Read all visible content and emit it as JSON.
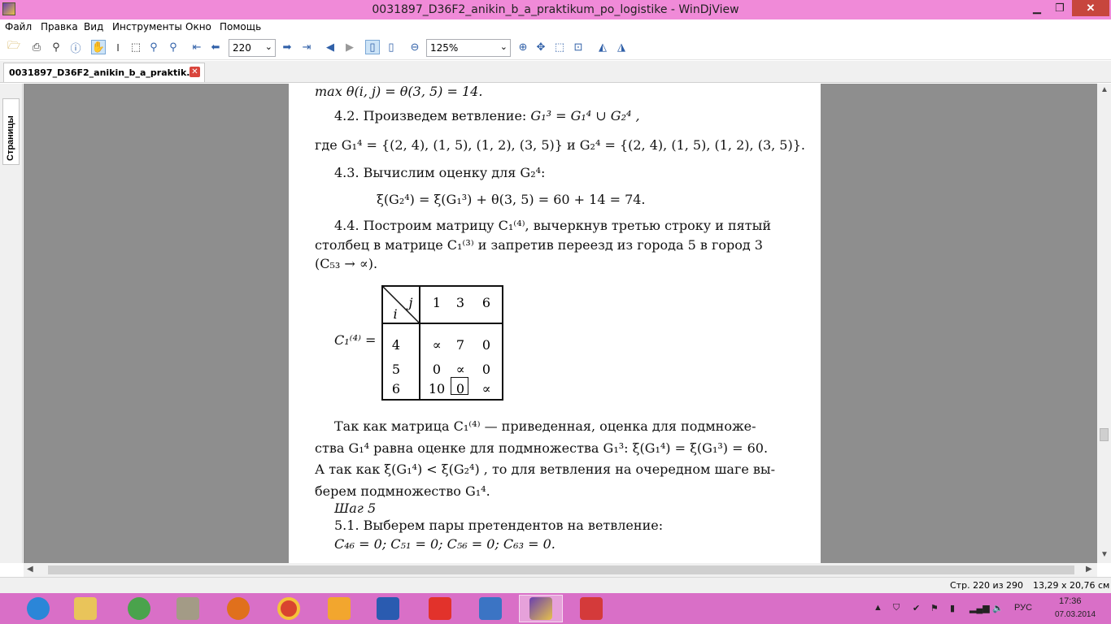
{
  "window": {
    "title": "0031897_D36F2_anikin_b_a_praktikum_po_logistike - WinDjView",
    "min_label": "▁",
    "max_label": "❐",
    "close_label": "✕"
  },
  "menu": [
    "Файл",
    "Правка",
    "Вид",
    "Инструменты",
    "Окно",
    "Помощь"
  ],
  "toolbar": {
    "page_value": "220",
    "zoom_value": "125%",
    "icons": [
      "open-icon",
      "print-icon",
      "find-icon",
      "info-icon",
      "hand-icon",
      "text-select-icon",
      "rect-select-icon",
      "zoom-in-tool-icon",
      "zoom-rect-icon",
      "first-page-icon",
      "prev-page-icon",
      "next-page-icon",
      "last-page-icon",
      "back-icon",
      "forward-icon",
      "single-page-icon",
      "two-page-icon",
      "zoom-out-icon",
      "zoom-plus-icon",
      "fit-page-icon",
      "fit-width-icon",
      "actual-size-icon",
      "rotate-left-icon",
      "rotate-right-icon"
    ]
  },
  "tab": {
    "label": "0031897_D36F2_anikin_b_a_praktik...",
    "close": "✕"
  },
  "sidebar": {
    "pages_tab": "Страницы"
  },
  "doc": {
    "line1": "max θ(i, j) = θ(3, 5) = 14.",
    "l2a": "4.2. Произведем ветвление: ",
    "l2b": "G₁³ = G₁⁴ ∪ G₂⁴ ,",
    "l3a": "где ",
    "l3b": "G₁⁴ = {(2, 4), (1, 5), (1, 2), (3, 5)}",
    "l3c": " и ",
    "l3d": "G₂⁴ = {(2, 4), (1, 5), (1, 2), (3, 5)}.",
    "l4": "4.3. Вычислим оценку для G₂⁴:",
    "l5": "ξ(G₂⁴) = ξ(G₁³) + θ(3, 5) = 60 + 14 = 74.",
    "l6": "4.4. Построим матрицу C₁⁽⁴⁾, вычеркнув третью строку и пятый",
    "l7": "столбец в матрице C₁⁽³⁾ и запретив переезд из города 5 в город 3",
    "l8": "(C₅₃ → ∝).",
    "matrix_label": "C₁⁽⁴⁾ =",
    "matrix": {
      "col_header": "j",
      "row_header": "i",
      "cols": [
        "1",
        "3",
        "6"
      ],
      "rows": [
        {
          "i": "4",
          "cells": [
            "∝",
            "7",
            "0"
          ]
        },
        {
          "i": "5",
          "cells": [
            "0",
            "∝",
            "0"
          ]
        },
        {
          "i": "6",
          "cells": [
            "10",
            "0",
            "∝"
          ]
        }
      ]
    },
    "p1": "Так как матрица C₁⁽⁴⁾ — приведенная, оценка для подмноже-",
    "p2": "ства G₁⁴ равна оценке для подмножества G₁³: ξ(G₁⁴) = ξ(G₁³) = 60.",
    "p3": "А так как ξ(G₁⁴) < ξ(G₂⁴) , то для ветвления на очередном шаге вы-",
    "p4": "берем подмножество G₁⁴.",
    "step": "Шаг 5",
    "s1": "5.1. Выберем пары претендентов на ветвление:",
    "s2": "C₄₆ = 0; C₅₁ = 0; C₅₆ = 0; C₆₃ = 0."
  },
  "status": {
    "page_info": "Стр. 220 из 290",
    "size_info": "13,29 x 20,76 см"
  },
  "taskbar": {
    "apps": [
      "ie-icon",
      "file-explorer-icon",
      "media-center-icon",
      "archive-icon",
      "firefox-icon",
      "chrome-icon",
      "video-player-icon",
      "word-icon",
      "yandex-icon",
      "speaker-app-icon",
      "windjview-icon",
      "remote-icon"
    ],
    "lang": "РУС",
    "time": "17:36",
    "date": "07.03.2014"
  }
}
